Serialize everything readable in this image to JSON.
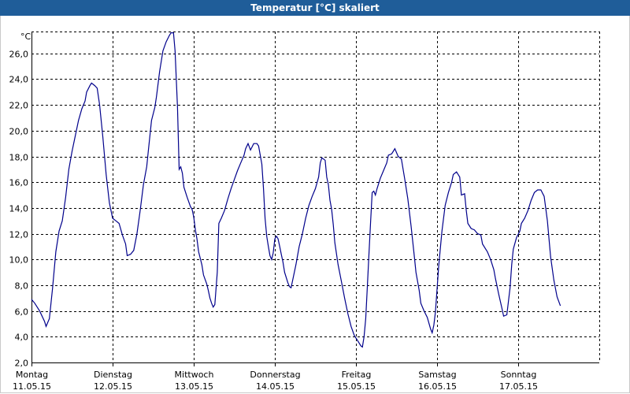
{
  "window": {
    "title": "Temperatur [°C] skaliert"
  },
  "chart_data": {
    "type": "line",
    "title": "Temperatur [°C] skaliert",
    "ylabel": "°C",
    "xlabel": "",
    "ylim": [
      2.0,
      27.7
    ],
    "yticks": [
      "2,0",
      "4,0",
      "6,0",
      "8,0",
      "10,0",
      "12,0",
      "14,0",
      "16,0",
      "18,0",
      "20,0",
      "22,0",
      "24,0",
      "26,0"
    ],
    "ytick_values": [
      2,
      4,
      6,
      8,
      10,
      12,
      14,
      16,
      18,
      20,
      22,
      24,
      26
    ],
    "days": [
      {
        "name": "Montag",
        "date": "11.05.15"
      },
      {
        "name": "Dienstag",
        "date": "12.05.15"
      },
      {
        "name": "Mittwoch",
        "date": "13.05.15"
      },
      {
        "name": "Donnerstag",
        "date": "14.05.15"
      },
      {
        "name": "Freitag",
        "date": "15.05.15"
      },
      {
        "name": "Samstag",
        "date": "16.05.15"
      },
      {
        "name": "Sonntag",
        "date": "17.05.15"
      }
    ],
    "grid": true,
    "line_color": "#00008b",
    "series": [
      {
        "name": "",
        "points": [
          [
            0.0,
            6.9
          ],
          [
            0.04,
            6.6
          ],
          [
            0.1,
            6.0
          ],
          [
            0.16,
            5.2
          ],
          [
            0.18,
            4.8
          ],
          [
            0.22,
            5.4
          ],
          [
            0.26,
            7.8
          ],
          [
            0.3,
            10.6
          ],
          [
            0.34,
            12.2
          ],
          [
            0.38,
            13.0
          ],
          [
            0.42,
            14.8
          ],
          [
            0.46,
            17.0
          ],
          [
            0.5,
            18.4
          ],
          [
            0.54,
            19.6
          ],
          [
            0.58,
            20.8
          ],
          [
            0.62,
            21.7
          ],
          [
            0.66,
            22.3
          ],
          [
            0.68,
            23.0
          ],
          [
            0.72,
            23.5
          ],
          [
            0.74,
            23.7
          ],
          [
            0.78,
            23.5
          ],
          [
            0.81,
            23.3
          ],
          [
            0.84,
            22.0
          ],
          [
            0.88,
            19.5
          ],
          [
            0.92,
            16.6
          ],
          [
            0.96,
            14.4
          ],
          [
            1.0,
            13.2
          ],
          [
            1.04,
            13.0
          ],
          [
            1.08,
            12.8
          ],
          [
            1.12,
            11.9
          ],
          [
            1.16,
            11.2
          ],
          [
            1.18,
            10.3
          ],
          [
            1.22,
            10.4
          ],
          [
            1.26,
            10.7
          ],
          [
            1.3,
            12.0
          ],
          [
            1.34,
            13.8
          ],
          [
            1.38,
            15.8
          ],
          [
            1.42,
            17.2
          ],
          [
            1.44,
            18.4
          ],
          [
            1.48,
            20.8
          ],
          [
            1.52,
            21.8
          ],
          [
            1.54,
            22.6
          ],
          [
            1.58,
            24.6
          ],
          [
            1.62,
            26.2
          ],
          [
            1.66,
            26.9
          ],
          [
            1.7,
            27.4
          ],
          [
            1.72,
            27.6
          ],
          [
            1.75,
            27.6
          ],
          [
            1.77,
            26.2
          ],
          [
            1.8,
            21.8
          ],
          [
            1.82,
            17.0
          ],
          [
            1.84,
            17.2
          ],
          [
            1.86,
            16.7
          ],
          [
            1.88,
            15.6
          ],
          [
            1.92,
            14.8
          ],
          [
            1.96,
            14.1
          ],
          [
            1.98,
            13.9
          ],
          [
            2.0,
            13.3
          ],
          [
            2.02,
            12.3
          ],
          [
            2.04,
            11.6
          ],
          [
            2.06,
            10.6
          ],
          [
            2.1,
            9.6
          ],
          [
            2.12,
            8.8
          ],
          [
            2.16,
            8.1
          ],
          [
            2.18,
            7.6
          ],
          [
            2.2,
            7.0
          ],
          [
            2.22,
            6.6
          ],
          [
            2.24,
            6.3
          ],
          [
            2.26,
            6.5
          ],
          [
            2.29,
            9.0
          ],
          [
            2.31,
            12.8
          ],
          [
            2.34,
            13.2
          ],
          [
            2.38,
            13.8
          ],
          [
            2.42,
            14.7
          ],
          [
            2.46,
            15.5
          ],
          [
            2.5,
            16.2
          ],
          [
            2.54,
            16.9
          ],
          [
            2.58,
            17.5
          ],
          [
            2.62,
            18.1
          ],
          [
            2.64,
            18.6
          ],
          [
            2.67,
            19.0
          ],
          [
            2.7,
            18.5
          ],
          [
            2.74,
            19.0
          ],
          [
            2.78,
            19.0
          ],
          [
            2.8,
            18.8
          ],
          [
            2.84,
            17.4
          ],
          [
            2.86,
            15.5
          ],
          [
            2.88,
            13.2
          ],
          [
            2.9,
            11.8
          ],
          [
            2.92,
            11.0
          ],
          [
            2.94,
            10.3
          ],
          [
            2.96,
            10.0
          ],
          [
            2.98,
            10.5
          ],
          [
            3.0,
            11.6
          ],
          [
            3.02,
            11.8
          ],
          [
            3.04,
            11.6
          ],
          [
            3.06,
            11.0
          ],
          [
            3.08,
            10.4
          ],
          [
            3.1,
            9.8
          ],
          [
            3.12,
            9.0
          ],
          [
            3.16,
            8.2
          ],
          [
            3.18,
            7.9
          ],
          [
            3.2,
            7.8
          ],
          [
            3.22,
            8.4
          ],
          [
            3.26,
            9.6
          ],
          [
            3.3,
            11.0
          ],
          [
            3.34,
            12.0
          ],
          [
            3.38,
            13.2
          ],
          [
            3.42,
            14.2
          ],
          [
            3.46,
            14.9
          ],
          [
            3.5,
            15.5
          ],
          [
            3.54,
            16.4
          ],
          [
            3.56,
            17.5
          ],
          [
            3.58,
            17.9
          ],
          [
            3.62,
            17.7
          ],
          [
            3.64,
            16.4
          ],
          [
            3.66,
            15.8
          ],
          [
            3.68,
            14.6
          ],
          [
            3.7,
            13.9
          ],
          [
            3.72,
            12.7
          ],
          [
            3.74,
            11.3
          ],
          [
            3.78,
            9.6
          ],
          [
            3.82,
            8.3
          ],
          [
            3.86,
            7.0
          ],
          [
            3.9,
            5.8
          ],
          [
            3.94,
            4.8
          ],
          [
            3.98,
            4.1
          ],
          [
            4.02,
            3.7
          ],
          [
            4.06,
            3.3
          ],
          [
            4.08,
            3.2
          ],
          [
            4.1,
            4.0
          ],
          [
            4.12,
            5.4
          ],
          [
            4.14,
            7.8
          ],
          [
            4.16,
            10.4
          ],
          [
            4.18,
            12.8
          ],
          [
            4.2,
            15.2
          ],
          [
            4.22,
            15.3
          ],
          [
            4.24,
            15.0
          ],
          [
            4.26,
            15.5
          ],
          [
            4.3,
            16.3
          ],
          [
            4.34,
            16.9
          ],
          [
            4.38,
            17.5
          ],
          [
            4.4,
            18.1
          ],
          [
            4.44,
            18.2
          ],
          [
            4.46,
            18.4
          ],
          [
            4.48,
            18.6
          ],
          [
            4.5,
            18.3
          ],
          [
            4.52,
            18.0
          ],
          [
            4.56,
            17.8
          ],
          [
            4.6,
            16.3
          ],
          [
            4.64,
            14.7
          ],
          [
            4.68,
            12.6
          ],
          [
            4.72,
            10.2
          ],
          [
            4.74,
            9.0
          ],
          [
            4.78,
            7.6
          ],
          [
            4.8,
            6.6
          ],
          [
            4.84,
            6.0
          ],
          [
            4.88,
            5.5
          ],
          [
            4.92,
            4.6
          ],
          [
            4.94,
            4.3
          ],
          [
            4.96,
            4.9
          ],
          [
            4.98,
            5.9
          ],
          [
            5.02,
            9.5
          ],
          [
            5.06,
            12.2
          ],
          [
            5.1,
            14.2
          ],
          [
            5.14,
            15.2
          ],
          [
            5.18,
            16.0
          ],
          [
            5.2,
            16.6
          ],
          [
            5.24,
            16.8
          ],
          [
            5.28,
            16.4
          ],
          [
            5.3,
            15.0
          ],
          [
            5.34,
            15.1
          ],
          [
            5.36,
            13.8
          ],
          [
            5.38,
            12.8
          ],
          [
            5.42,
            12.4
          ],
          [
            5.46,
            12.3
          ],
          [
            5.5,
            12.0
          ],
          [
            5.54,
            11.9
          ],
          [
            5.56,
            11.2
          ],
          [
            5.6,
            10.8
          ],
          [
            5.62,
            10.6
          ],
          [
            5.66,
            10.0
          ],
          [
            5.7,
            9.2
          ],
          [
            5.72,
            8.5
          ],
          [
            5.76,
            7.3
          ],
          [
            5.8,
            6.2
          ],
          [
            5.82,
            5.6
          ],
          [
            5.86,
            5.7
          ],
          [
            5.9,
            7.8
          ],
          [
            5.92,
            9.6
          ],
          [
            5.94,
            10.8
          ],
          [
            5.98,
            11.7
          ],
          [
            6.02,
            12.2
          ],
          [
            6.04,
            12.8
          ],
          [
            6.08,
            13.2
          ],
          [
            6.12,
            13.8
          ],
          [
            6.16,
            14.6
          ],
          [
            6.2,
            15.2
          ],
          [
            6.24,
            15.4
          ],
          [
            6.28,
            15.4
          ],
          [
            6.32,
            14.9
          ],
          [
            6.36,
            13.0
          ],
          [
            6.4,
            10.2
          ],
          [
            6.44,
            8.4
          ],
          [
            6.48,
            7.1
          ],
          [
            6.52,
            6.4
          ]
        ]
      }
    ]
  }
}
